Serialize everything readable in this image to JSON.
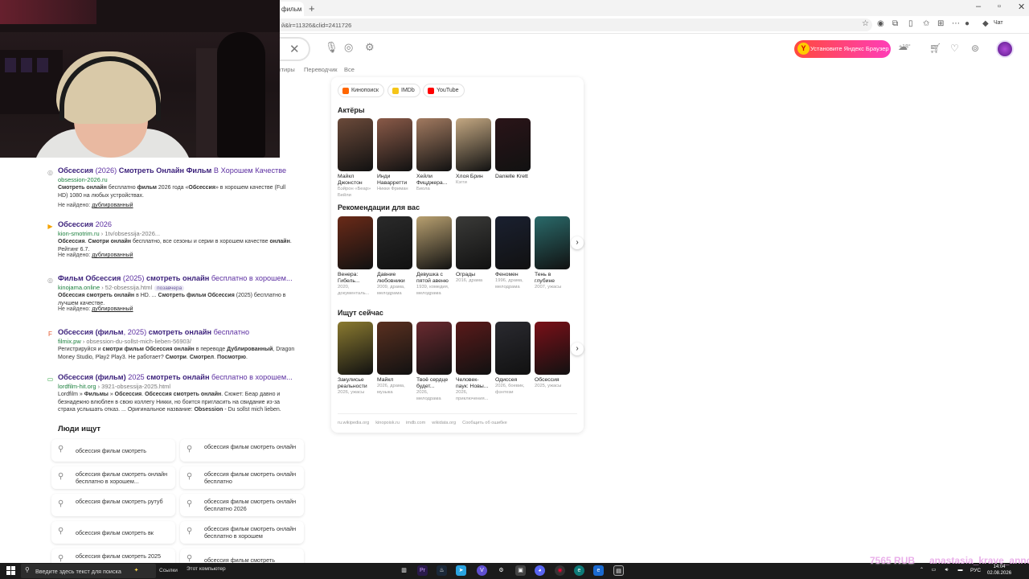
{
  "browser": {
    "tab_title": "фильм с",
    "url": "й&lr=11326&clid=2411726",
    "copilot_label": "Чат"
  },
  "header": {
    "install_button": "Установите Яндекс Браузер",
    "weather": "+18°"
  },
  "search_tabs": [
    "...ктиры",
    "Переводчик",
    "Все"
  ],
  "results": [
    {
      "title_html": "<b>Обсессия</b> (2026) <b>Смотреть Онлайн Фильм</b> В Хорошем Качестве",
      "domain": "obsession-2026.ru",
      "path": "",
      "badge": "",
      "snippet_html": "<b>Смотреть онлайн</b> бесплатно <b>фильм</b> 2026 года «<b>Обсессия</b>» в хорошем качестве (Full HD) 1080 на любых устройствах.",
      "not_found": "Не найдено:",
      "not_found_word": "дублированный",
      "favicon": "◎"
    },
    {
      "title_html": "<b>Обсессия</b> 2026",
      "domain": "kion-smotrim.ru",
      "path": " › 1tv/obsessija-2026...",
      "badge": "",
      "snippet_html": "<b>Обсессия</b>. <b>Смотри онлайн</b> бесплатно, все сезоны и серии в хорошем качестве <b>онлайн</b>. Рейтинг 6.7.",
      "not_found": "Не найдено:",
      "not_found_word": "дублированный",
      "favicon": "▶"
    },
    {
      "title_html": "<b>Фильм Обсессия</b> (2025) <b>смотреть онлайн</b> бесплатно в хорошем...",
      "domain": "kinojama.online",
      "path": " › 52-obsessija.html",
      "badge": "позавчера",
      "snippet_html": "<b>Обсессия смотреть онлайн</b> в HD. ... <b>Смотреть фильм Обсессия</b> (2025) бесплатно в лучшем качестве.",
      "not_found": "Не найдено:",
      "not_found_word": "дублированный",
      "favicon": "◎"
    },
    {
      "title_html": "<b>Обсессия (фильм</b>, 2025) <b>смотреть онлайн</b> бесплатно",
      "domain": "filmix.pw",
      "path": " › obsession-du-sollst-mich-lieben-56903/",
      "badge": "",
      "snippet_html": "Регистрируйся и <b>смотри фильм Обсессия онлайн</b> в переводе <b>Дублированный</b>, Dragon Money Studio, Play2 Play3. Не работает? <b>Смотри</b>. <b>Смотрел</b>. <b>Посмотрю</b>.",
      "not_found": "",
      "not_found_word": "",
      "favicon": "F"
    },
    {
      "title_html": "<b>Обсессия (фильм)</b> 2025 <b>смотреть онлайн</b> бесплатно в хорошем...",
      "domain": "lordfilm-hit.org",
      "path": " › 3921-obsessija-2025.html",
      "badge": "",
      "snippet_html": "Lordfilm » <b>Фильмы</b> » <b>Обсессия</b>. <b>Обсессия смотреть онлайн</b>. Сюжет: Беар давно и безнадежно влюблен в свою коллегу Никки, но боится пригласить на свидание из-за страха услышать отказ. ... Оригинальное название: <b>Obsession</b> - Du sollst mich lieben.",
      "not_found": "",
      "not_found_word": "",
      "favicon": "▭"
    }
  ],
  "people_search": {
    "title": "Люди ищут",
    "chips": [
      "обсессия фильм смотреть",
      "обсессия фильм смотреть онлайн",
      "обсессия фильм смотреть онлайн бесплатно в хорошем...",
      "обсессия фильм смотреть онлайн бесплатно",
      "обсессия фильм смотреть рутуб",
      "обсессия фильм смотреть онлайн бесплатно 2026",
      "обсессия фильм смотреть вк",
      "обсессия фильм смотреть онлайн бесплатно в хорошем",
      "обсессия фильм смотреть 2025",
      "обсессия фильм смотреть"
    ]
  },
  "knowledge_panel": {
    "sources": [
      "Кинопоиск",
      "IMDb",
      "YouTube"
    ],
    "actors_title": "Актёры",
    "actors": [
      {
        "name": "Майкл Джонстон",
        "role": "Бэйрон «Беар» Бейли",
        "color": "#6b4a3a"
      },
      {
        "name": "Инди Наварретти",
        "role": "Никки Фриман",
        "color": "#8a5a48"
      },
      {
        "name": "Хейли Фицджера...",
        "role": "Биола",
        "color": "#a27a60"
      },
      {
        "name": "Хлоя Брин",
        "role": "Кэгги",
        "color": "#c4a882"
      },
      {
        "name": "Danielle Krett",
        "role": "",
        "color": "#2a1418"
      }
    ],
    "recs_title": "Рекомендации для вас",
    "recs": [
      {
        "name": "Венера: Гибель...",
        "meta": "2020, документаль...",
        "color": "#6a2a18"
      },
      {
        "name": "Давние любовники",
        "meta": "2009, драма, мелодрама",
        "color": "#2a2a2a"
      },
      {
        "name": "Девушка с пятой авеню",
        "meta": "1939, комедия, мелодрама",
        "color": "#b8a070"
      },
      {
        "name": "Ограды",
        "meta": "2016, драма",
        "color": "#3a3a38"
      },
      {
        "name": "Феномен",
        "meta": "1996, драма, мелодрама",
        "color": "#1a2030"
      },
      {
        "name": "Тень в глубине",
        "meta": "2007, ужасы",
        "color": "#2a6a6a"
      },
      {
        "name": "К...",
        "meta": "",
        "color": "#8a3a6a"
      }
    ],
    "now_title": "Ищут сейчас",
    "now": [
      {
        "name": "Закулисье реальности",
        "meta": "2026, ужасы",
        "color": "#8a7a30"
      },
      {
        "name": "Майкл",
        "meta": "2026, драма, музыка",
        "color": "#5a3020"
      },
      {
        "name": "Твоё сердце будет...",
        "meta": "2026, мелодрама",
        "color": "#6a2a30"
      },
      {
        "name": "Человек-паук: Новы...",
        "meta": "2026, приключения...",
        "color": "#5a1a1a"
      },
      {
        "name": "Одиссея",
        "meta": "2026, боевик, фэнтези",
        "color": "#2a2a30"
      },
      {
        "name": "Обсессия",
        "meta": "2025, ужасы",
        "color": "#7a1018"
      },
      {
        "name": "М...",
        "meta": "",
        "color": "#a01818"
      }
    ],
    "footer": [
      "ru.wikipedia.org",
      "kinopoisk.ru",
      "imdb.com",
      "wikidata.org",
      "Сообщить об ошибке"
    ]
  },
  "taskbar": {
    "search_placeholder": "Введите здесь текст для поиска",
    "links_label": "Ссылки",
    "mypc_label": "Этот компьютер",
    "lang": "РУС",
    "time": "14:04",
    "date": "02.08.2026"
  },
  "overlays": {
    "amount": "7565 RUB",
    "nickname": "anastasia_krave_anno"
  }
}
